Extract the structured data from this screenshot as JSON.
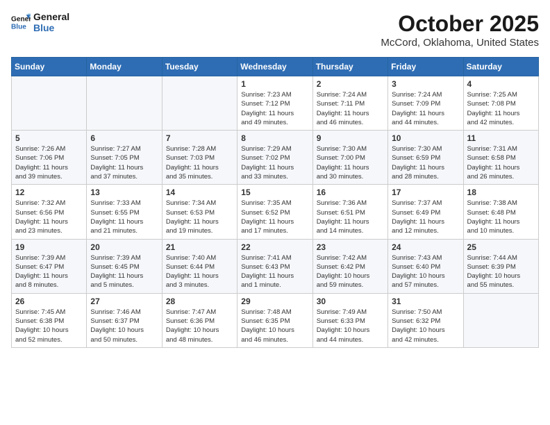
{
  "logo": {
    "line1": "General",
    "line2": "Blue"
  },
  "title": "October 2025",
  "location": "McCord, Oklahoma, United States",
  "weekdays": [
    "Sunday",
    "Monday",
    "Tuesday",
    "Wednesday",
    "Thursday",
    "Friday",
    "Saturday"
  ],
  "weeks": [
    [
      {
        "day": "",
        "info": ""
      },
      {
        "day": "",
        "info": ""
      },
      {
        "day": "",
        "info": ""
      },
      {
        "day": "1",
        "info": "Sunrise: 7:23 AM\nSunset: 7:12 PM\nDaylight: 11 hours\nand 49 minutes."
      },
      {
        "day": "2",
        "info": "Sunrise: 7:24 AM\nSunset: 7:11 PM\nDaylight: 11 hours\nand 46 minutes."
      },
      {
        "day": "3",
        "info": "Sunrise: 7:24 AM\nSunset: 7:09 PM\nDaylight: 11 hours\nand 44 minutes."
      },
      {
        "day": "4",
        "info": "Sunrise: 7:25 AM\nSunset: 7:08 PM\nDaylight: 11 hours\nand 42 minutes."
      }
    ],
    [
      {
        "day": "5",
        "info": "Sunrise: 7:26 AM\nSunset: 7:06 PM\nDaylight: 11 hours\nand 39 minutes."
      },
      {
        "day": "6",
        "info": "Sunrise: 7:27 AM\nSunset: 7:05 PM\nDaylight: 11 hours\nand 37 minutes."
      },
      {
        "day": "7",
        "info": "Sunrise: 7:28 AM\nSunset: 7:03 PM\nDaylight: 11 hours\nand 35 minutes."
      },
      {
        "day": "8",
        "info": "Sunrise: 7:29 AM\nSunset: 7:02 PM\nDaylight: 11 hours\nand 33 minutes."
      },
      {
        "day": "9",
        "info": "Sunrise: 7:30 AM\nSunset: 7:00 PM\nDaylight: 11 hours\nand 30 minutes."
      },
      {
        "day": "10",
        "info": "Sunrise: 7:30 AM\nSunset: 6:59 PM\nDaylight: 11 hours\nand 28 minutes."
      },
      {
        "day": "11",
        "info": "Sunrise: 7:31 AM\nSunset: 6:58 PM\nDaylight: 11 hours\nand 26 minutes."
      }
    ],
    [
      {
        "day": "12",
        "info": "Sunrise: 7:32 AM\nSunset: 6:56 PM\nDaylight: 11 hours\nand 23 minutes."
      },
      {
        "day": "13",
        "info": "Sunrise: 7:33 AM\nSunset: 6:55 PM\nDaylight: 11 hours\nand 21 minutes."
      },
      {
        "day": "14",
        "info": "Sunrise: 7:34 AM\nSunset: 6:53 PM\nDaylight: 11 hours\nand 19 minutes."
      },
      {
        "day": "15",
        "info": "Sunrise: 7:35 AM\nSunset: 6:52 PM\nDaylight: 11 hours\nand 17 minutes."
      },
      {
        "day": "16",
        "info": "Sunrise: 7:36 AM\nSunset: 6:51 PM\nDaylight: 11 hours\nand 14 minutes."
      },
      {
        "day": "17",
        "info": "Sunrise: 7:37 AM\nSunset: 6:49 PM\nDaylight: 11 hours\nand 12 minutes."
      },
      {
        "day": "18",
        "info": "Sunrise: 7:38 AM\nSunset: 6:48 PM\nDaylight: 11 hours\nand 10 minutes."
      }
    ],
    [
      {
        "day": "19",
        "info": "Sunrise: 7:39 AM\nSunset: 6:47 PM\nDaylight: 11 hours\nand 8 minutes."
      },
      {
        "day": "20",
        "info": "Sunrise: 7:39 AM\nSunset: 6:45 PM\nDaylight: 11 hours\nand 5 minutes."
      },
      {
        "day": "21",
        "info": "Sunrise: 7:40 AM\nSunset: 6:44 PM\nDaylight: 11 hours\nand 3 minutes."
      },
      {
        "day": "22",
        "info": "Sunrise: 7:41 AM\nSunset: 6:43 PM\nDaylight: 11 hours\nand 1 minute."
      },
      {
        "day": "23",
        "info": "Sunrise: 7:42 AM\nSunset: 6:42 PM\nDaylight: 10 hours\nand 59 minutes."
      },
      {
        "day": "24",
        "info": "Sunrise: 7:43 AM\nSunset: 6:40 PM\nDaylight: 10 hours\nand 57 minutes."
      },
      {
        "day": "25",
        "info": "Sunrise: 7:44 AM\nSunset: 6:39 PM\nDaylight: 10 hours\nand 55 minutes."
      }
    ],
    [
      {
        "day": "26",
        "info": "Sunrise: 7:45 AM\nSunset: 6:38 PM\nDaylight: 10 hours\nand 52 minutes."
      },
      {
        "day": "27",
        "info": "Sunrise: 7:46 AM\nSunset: 6:37 PM\nDaylight: 10 hours\nand 50 minutes."
      },
      {
        "day": "28",
        "info": "Sunrise: 7:47 AM\nSunset: 6:36 PM\nDaylight: 10 hours\nand 48 minutes."
      },
      {
        "day": "29",
        "info": "Sunrise: 7:48 AM\nSunset: 6:35 PM\nDaylight: 10 hours\nand 46 minutes."
      },
      {
        "day": "30",
        "info": "Sunrise: 7:49 AM\nSunset: 6:33 PM\nDaylight: 10 hours\nand 44 minutes."
      },
      {
        "day": "31",
        "info": "Sunrise: 7:50 AM\nSunset: 6:32 PM\nDaylight: 10 hours\nand 42 minutes."
      },
      {
        "day": "",
        "info": ""
      }
    ]
  ]
}
